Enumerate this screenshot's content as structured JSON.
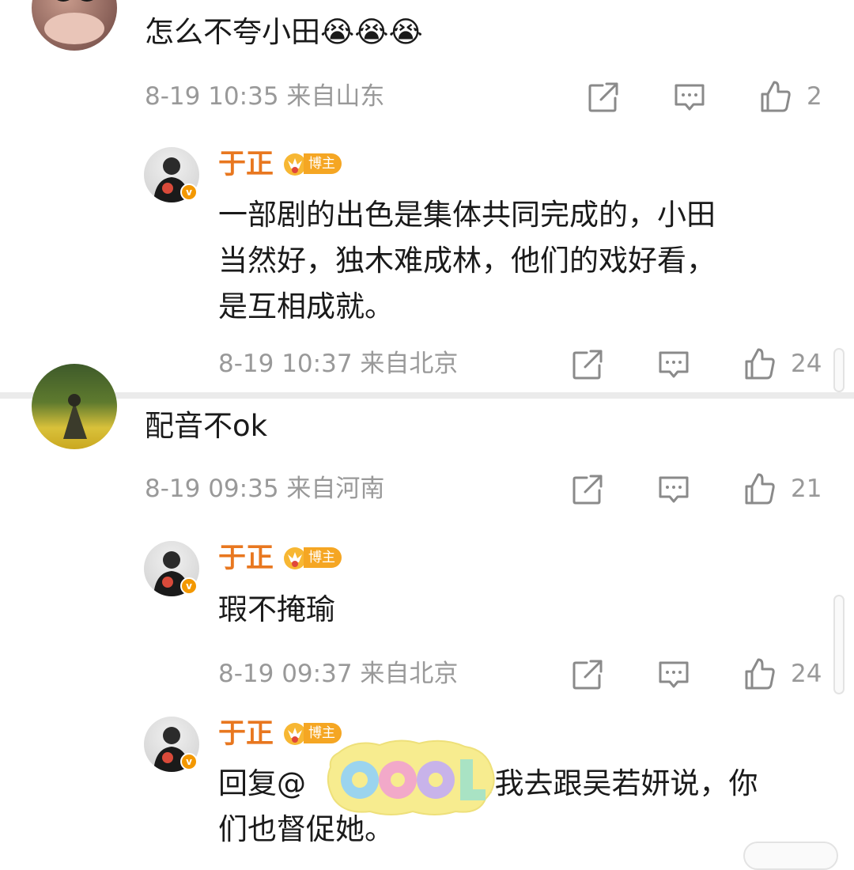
{
  "comments": [
    {
      "text": "怎么不夸小田😭😭😭",
      "time": "8-19 10:35",
      "location": "来自山东",
      "likes": "2",
      "reply": {
        "author": "于正",
        "badge": "博主",
        "text_lines": [
          "一部剧的出色是集体共同完成的，小田",
          "当然好，独木难成林，他们的戏好看，",
          "是互相成就。"
        ],
        "time": "8-19 10:37",
        "location": "来自北京",
        "likes": "24"
      }
    },
    {
      "text": "配音不ok",
      "time": "8-19 09:35",
      "location": "来自河南",
      "likes": "21",
      "replies": [
        {
          "author": "于正",
          "badge": "博主",
          "text": "瑕不掩瑜",
          "time": "8-19 09:37",
          "location": "来自北京",
          "likes": "24"
        },
        {
          "author": "于正",
          "badge": "博主",
          "text_line1_prefix": "回复@",
          "text_line1_suffix": ":我去跟吴若妍说，你",
          "text_line2": "们也督促她。"
        }
      ]
    }
  ],
  "icons": {
    "share": "share-icon",
    "comment": "comment-icon",
    "like": "thumbs-up-icon"
  },
  "colors": {
    "nickname": "#e8771f",
    "badge": "#f5a623",
    "meta": "#999999",
    "text": "#1a1a1a"
  }
}
